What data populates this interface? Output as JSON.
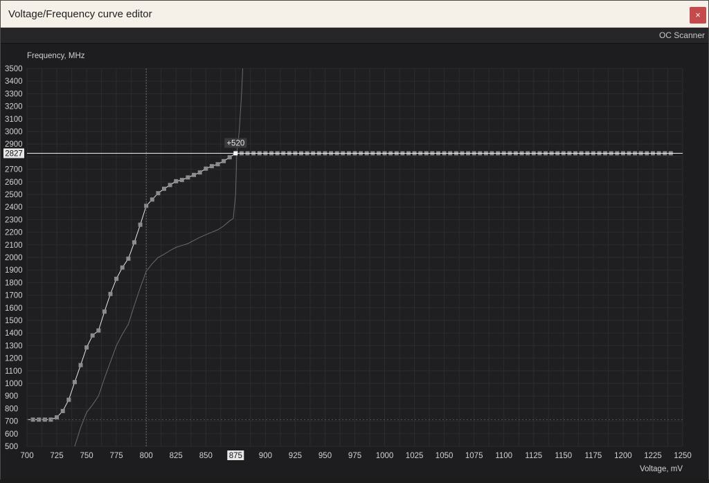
{
  "window": {
    "title": "Voltage/Frequency curve editor",
    "close_symbol": "×"
  },
  "toolbar": {
    "oc_scanner_label": "OC Scanner"
  },
  "colors": {
    "background": "#1d1d1f",
    "grid": "#2c2c2f",
    "axis_text": "#d2d2d2",
    "curve": "#e6e6e6",
    "curve_point": "#8c8c8c",
    "baseline_curve": "#6a6a6a",
    "close_button": "#c6494b"
  },
  "chart_data": {
    "type": "line",
    "ylabel": "Frequency, MHz",
    "xlabel": "Voltage, mV",
    "xlim": [
      700,
      1250
    ],
    "ylim": [
      500,
      3500
    ],
    "x_ticks": [
      700,
      725,
      750,
      775,
      800,
      825,
      850,
      875,
      900,
      925,
      950,
      975,
      1000,
      1025,
      1050,
      1075,
      1100,
      1125,
      1150,
      1175,
      1200,
      1225,
      1250
    ],
    "y_ticks": [
      500,
      600,
      700,
      800,
      900,
      1000,
      1100,
      1200,
      1300,
      1400,
      1500,
      1600,
      1700,
      1800,
      1900,
      2000,
      2100,
      2200,
      2300,
      2400,
      2500,
      2600,
      2700,
      2800,
      2900,
      3000,
      3100,
      3200,
      3300,
      3400,
      3500
    ],
    "grid": true,
    "selected_point": {
      "voltage": 875,
      "frequency": 2827,
      "offset_label": "+520",
      "voltage_label": "875",
      "frequency_label": "2827"
    },
    "cursor_voltage": 800,
    "min_frequency_line": 712,
    "series": [
      {
        "points": [
          [
            700,
            712
          ],
          [
            705,
            712
          ],
          [
            710,
            712
          ],
          [
            715,
            712
          ],
          [
            720,
            712
          ],
          [
            725,
            730
          ],
          [
            730,
            780
          ],
          [
            735,
            870
          ],
          [
            740,
            1010
          ],
          [
            745,
            1145
          ],
          [
            750,
            1285
          ],
          [
            755,
            1380
          ],
          [
            760,
            1420
          ],
          [
            765,
            1570
          ],
          [
            770,
            1710
          ],
          [
            775,
            1830
          ],
          [
            780,
            1920
          ],
          [
            785,
            1990
          ],
          [
            790,
            2120
          ],
          [
            795,
            2260
          ],
          [
            800,
            2410
          ],
          [
            805,
            2460
          ],
          [
            810,
            2510
          ],
          [
            815,
            2545
          ],
          [
            820,
            2575
          ],
          [
            825,
            2605
          ],
          [
            830,
            2615
          ],
          [
            835,
            2635
          ],
          [
            840,
            2655
          ],
          [
            845,
            2675
          ],
          [
            850,
            2705
          ],
          [
            855,
            2725
          ],
          [
            860,
            2740
          ],
          [
            865,
            2765
          ],
          [
            870,
            2795
          ],
          [
            875,
            2827
          ],
          [
            880,
            2827
          ],
          [
            885,
            2827
          ],
          [
            890,
            2827
          ],
          [
            895,
            2827
          ],
          [
            900,
            2827
          ],
          [
            905,
            2827
          ],
          [
            910,
            2827
          ],
          [
            915,
            2827
          ],
          [
            920,
            2827
          ],
          [
            925,
            2827
          ],
          [
            930,
            2827
          ],
          [
            935,
            2827
          ],
          [
            940,
            2827
          ],
          [
            945,
            2827
          ],
          [
            950,
            2827
          ],
          [
            955,
            2827
          ],
          [
            960,
            2827
          ],
          [
            965,
            2827
          ],
          [
            970,
            2827
          ],
          [
            975,
            2827
          ],
          [
            980,
            2827
          ],
          [
            985,
            2827
          ],
          [
            990,
            2827
          ],
          [
            995,
            2827
          ],
          [
            1000,
            2827
          ],
          [
            1005,
            2827
          ],
          [
            1010,
            2827
          ],
          [
            1015,
            2827
          ],
          [
            1020,
            2827
          ],
          [
            1025,
            2827
          ],
          [
            1030,
            2827
          ],
          [
            1035,
            2827
          ],
          [
            1040,
            2827
          ],
          [
            1045,
            2827
          ],
          [
            1050,
            2827
          ],
          [
            1055,
            2827
          ],
          [
            1060,
            2827
          ],
          [
            1065,
            2827
          ],
          [
            1070,
            2827
          ],
          [
            1075,
            2827
          ],
          [
            1080,
            2827
          ],
          [
            1085,
            2827
          ],
          [
            1090,
            2827
          ],
          [
            1095,
            2827
          ],
          [
            1100,
            2827
          ],
          [
            1105,
            2827
          ],
          [
            1110,
            2827
          ],
          [
            1115,
            2827
          ],
          [
            1120,
            2827
          ],
          [
            1125,
            2827
          ],
          [
            1130,
            2827
          ],
          [
            1135,
            2827
          ],
          [
            1140,
            2827
          ],
          [
            1145,
            2827
          ],
          [
            1150,
            2827
          ],
          [
            1155,
            2827
          ],
          [
            1160,
            2827
          ],
          [
            1165,
            2827
          ],
          [
            1170,
            2827
          ],
          [
            1175,
            2827
          ],
          [
            1180,
            2827
          ],
          [
            1185,
            2827
          ],
          [
            1190,
            2827
          ],
          [
            1195,
            2827
          ],
          [
            1200,
            2827
          ],
          [
            1205,
            2827
          ],
          [
            1210,
            2827
          ],
          [
            1215,
            2827
          ],
          [
            1220,
            2827
          ],
          [
            1225,
            2827
          ],
          [
            1230,
            2827
          ],
          [
            1235,
            2827
          ],
          [
            1240,
            2827
          ],
          [
            1250,
            2827
          ]
        ]
      },
      {
        "points": [
          [
            740,
            500
          ],
          [
            745,
            650
          ],
          [
            750,
            770
          ],
          [
            755,
            830
          ],
          [
            760,
            900
          ],
          [
            765,
            1040
          ],
          [
            770,
            1170
          ],
          [
            775,
            1300
          ],
          [
            780,
            1390
          ],
          [
            785,
            1470
          ],
          [
            790,
            1620
          ],
          [
            795,
            1760
          ],
          [
            800,
            1890
          ],
          [
            805,
            1950
          ],
          [
            810,
            2000
          ],
          [
            815,
            2025
          ],
          [
            820,
            2055
          ],
          [
            825,
            2080
          ],
          [
            830,
            2095
          ],
          [
            835,
            2110
          ],
          [
            840,
            2135
          ],
          [
            845,
            2160
          ],
          [
            850,
            2180
          ],
          [
            855,
            2200
          ],
          [
            860,
            2220
          ],
          [
            865,
            2250
          ],
          [
            870,
            2290
          ],
          [
            873,
            2310
          ],
          [
            875,
            2500
          ],
          [
            876,
            2827
          ],
          [
            878,
            3000
          ],
          [
            880,
            3300
          ],
          [
            881,
            3500
          ]
        ]
      }
    ]
  }
}
